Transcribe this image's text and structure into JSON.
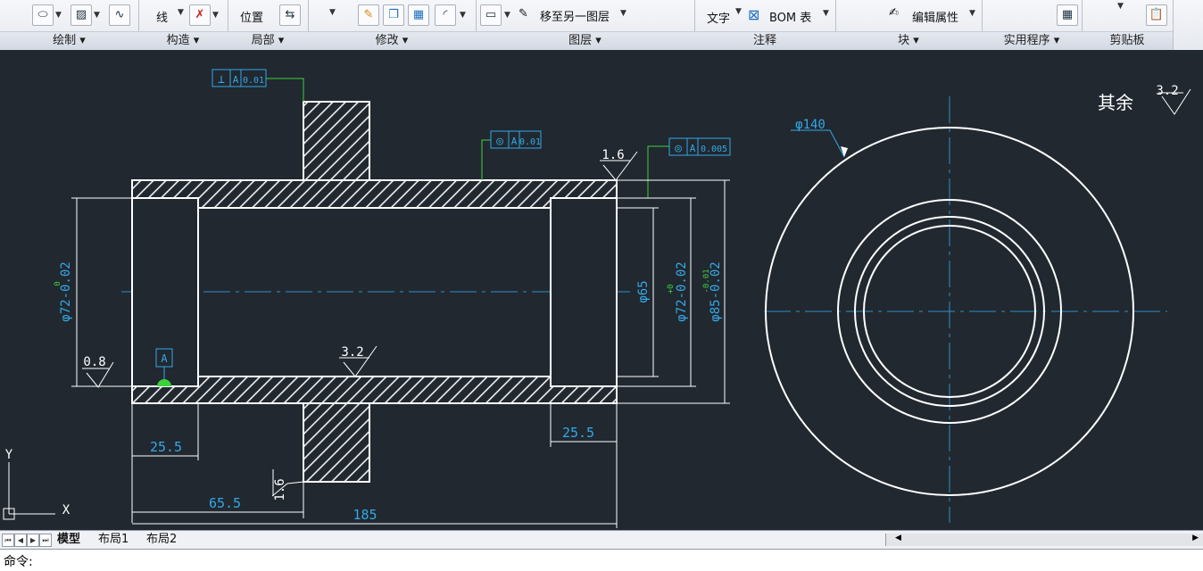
{
  "ribbon": {
    "panels": [
      {
        "title": "绘制 ▾"
      },
      {
        "title": "构造 ▾"
      },
      {
        "title": "局部 ▾"
      },
      {
        "title": "修改 ▾"
      },
      {
        "title": "图层 ▾"
      },
      {
        "title": "注释"
      },
      {
        "title": "块 ▾"
      },
      {
        "title": "实用程序 ▾"
      },
      {
        "title": "剪贴板"
      }
    ],
    "construct_line_label": "线",
    "local_position_label": "位置",
    "move_to_layer_label": "移至另一图层",
    "text_label": "文字",
    "bom_label": "BOM 表",
    "edit_attr_label": "编辑属性"
  },
  "drawing": {
    "gdt_perp": {
      "sym": "⊥",
      "datum": "A",
      "tol": "0.01"
    },
    "gdt_conc1": {
      "sym": "◎",
      "datum": "A",
      "tol": "0.01"
    },
    "gdt_conc2": {
      "sym": "◎",
      "datum": "A",
      "tol": "0.005"
    },
    "datum_label": "A",
    "dim_dia72": "φ72-0.02",
    "dim_dia72_sup": "0",
    "dim_dia65": "φ65",
    "dim_dia72b": "φ72-0.02",
    "dim_dia72b_sup": "+0",
    "dim_dia85": "φ85-0.02",
    "dim_dia85_sup": "-0.01",
    "dim_25_5_left": "25.5",
    "dim_25_5_right": "25.5",
    "dim_65_5": "65.5",
    "dim_185": "185",
    "dim_dia140": "φ140",
    "rough_08": "0.8",
    "rough_16_top": "1.6",
    "rough_32": "3.2",
    "rough_16_bottom": "1.6",
    "rest_label": "其余",
    "rest_rough": "3.2",
    "ucs_y": "Y",
    "ucs_x": "X"
  },
  "tabs": {
    "model": "模型",
    "layout1": "布局1",
    "layout2": "布局2"
  },
  "command": {
    "prompt": "命令:"
  },
  "colors": {
    "canvas": "#212830",
    "geometry": "#ffffff",
    "dimension": "#34a9e6",
    "leader": "#3cd23c",
    "centerline": "#2f8fc4"
  }
}
